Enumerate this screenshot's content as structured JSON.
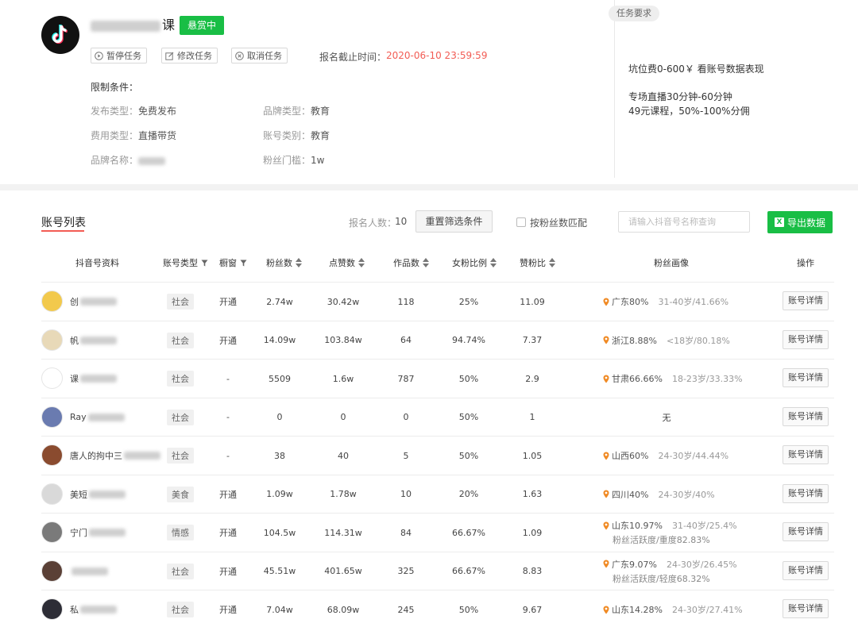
{
  "task": {
    "title": "课",
    "status": "悬赏中",
    "actions": [
      "暂停任务",
      "修改任务",
      "取消任务"
    ],
    "deadline_label": "报名截止时间：",
    "deadline": "2020-06-10 23:59:59",
    "limits_title": "限制条件：",
    "conditions": [
      {
        "label": "发布类型：",
        "value": "免费发布"
      },
      {
        "label": "品牌类型：",
        "value": "教育"
      },
      {
        "label": "费用类型：",
        "value": "直播带货"
      },
      {
        "label": "账号类别：",
        "value": "教育"
      },
      {
        "label": "品牌名称：",
        "value": ""
      },
      {
        "label": "粉丝门槛：",
        "value": "1w"
      }
    ],
    "requirements_badge": "任务要求",
    "requirements": [
      "坑位费0-600￥ 看账号数据表现",
      "专场直播30分钟-60分钟",
      "49元课程，50%-100%分佣"
    ]
  },
  "list": {
    "title": "账号列表",
    "count_label": "报名人数：",
    "count": "10",
    "reset_label": "重置筛选条件",
    "match_label": "按粉丝数匹配",
    "search_placeholder": "请输入抖音号名称查询",
    "export_label": "导出数据",
    "headers": [
      "抖音号资料",
      "账号类型",
      "橱窗",
      "粉丝数",
      "点赞数",
      "作品数",
      "女粉比例",
      "赞粉比",
      "粉丝画像",
      "操作"
    ],
    "rows": [
      {
        "name": "创",
        "type": "社会",
        "window": "开通",
        "fans": "2.74w",
        "likes": "30.42w",
        "works": "118",
        "female": "25%",
        "ratio": "11.09",
        "region": "广东80%",
        "age": "31-40岁/41.66%",
        "activity": "",
        "detail": "账号详情",
        "avatar_color": "#f2c94c"
      },
      {
        "name": "帆",
        "type": "社会",
        "window": "开通",
        "fans": "14.09w",
        "likes": "103.84w",
        "works": "64",
        "female": "94.74%",
        "ratio": "7.37",
        "region": "浙江8.88%",
        "age": "<18岁/80.18%",
        "activity": "",
        "detail": "账号详情",
        "avatar_color": "#e8d9b8"
      },
      {
        "name": "课",
        "type": "社会",
        "window": "-",
        "fans": "5509",
        "likes": "1.6w",
        "works": "787",
        "female": "50%",
        "ratio": "2.9",
        "region": "甘肃66.66%",
        "age": "18-23岁/33.33%",
        "activity": "",
        "detail": "账号详情",
        "avatar_color": "#ffffff"
      },
      {
        "name": "Ray",
        "type": "社会",
        "window": "-",
        "fans": "0",
        "likes": "0",
        "works": "0",
        "female": "50%",
        "ratio": "1",
        "region": "",
        "age": "",
        "activity": "",
        "none_label": "无",
        "detail": "账号详情",
        "avatar_color": "#6a7bb0"
      },
      {
        "name": "唐人的拘中三",
        "type": "社会",
        "window": "-",
        "fans": "38",
        "likes": "40",
        "works": "5",
        "female": "50%",
        "ratio": "1.05",
        "region": "山西60%",
        "age": "24-30岁/44.44%",
        "activity": "",
        "detail": "账号详情",
        "avatar_color": "#8a4b2f"
      },
      {
        "name": "美短",
        "type": "美食",
        "window": "开通",
        "fans": "1.09w",
        "likes": "1.78w",
        "works": "10",
        "female": "20%",
        "ratio": "1.63",
        "region": "四川40%",
        "age": "24-30岁/40%",
        "activity": "",
        "detail": "账号详情",
        "avatar_color": "#d9d9d9"
      },
      {
        "name": "宁门",
        "type": "情感",
        "window": "开通",
        "fans": "104.5w",
        "likes": "114.31w",
        "works": "84",
        "female": "66.67%",
        "ratio": "1.09",
        "region": "山东10.97%",
        "age": "31-40岁/25.4%",
        "activity": "粉丝活跃度/重度82.83%",
        "detail": "账号详情",
        "avatar_color": "#7a7a7a"
      },
      {
        "name": "",
        "type": "社会",
        "window": "开通",
        "fans": "45.51w",
        "likes": "401.65w",
        "works": "325",
        "female": "66.67%",
        "ratio": "8.83",
        "region": "广东9.07%",
        "age": "24-30岁/26.45%",
        "activity": "粉丝活跃度/轻度68.32%",
        "detail": "账号详情",
        "avatar_color": "#5a4036"
      },
      {
        "name": "私",
        "type": "社会",
        "window": "开通",
        "fans": "7.04w",
        "likes": "68.09w",
        "works": "245",
        "female": "50%",
        "ratio": "9.67",
        "region": "山东14.28%",
        "age": "24-30岁/27.41%",
        "activity": "",
        "detail": "账号详情",
        "avatar_color": "#2d2d36"
      }
    ]
  },
  "colors": {
    "accent_green": "#19be45",
    "accent_red": "#f25c54",
    "pin_orange": "#f08a24"
  }
}
